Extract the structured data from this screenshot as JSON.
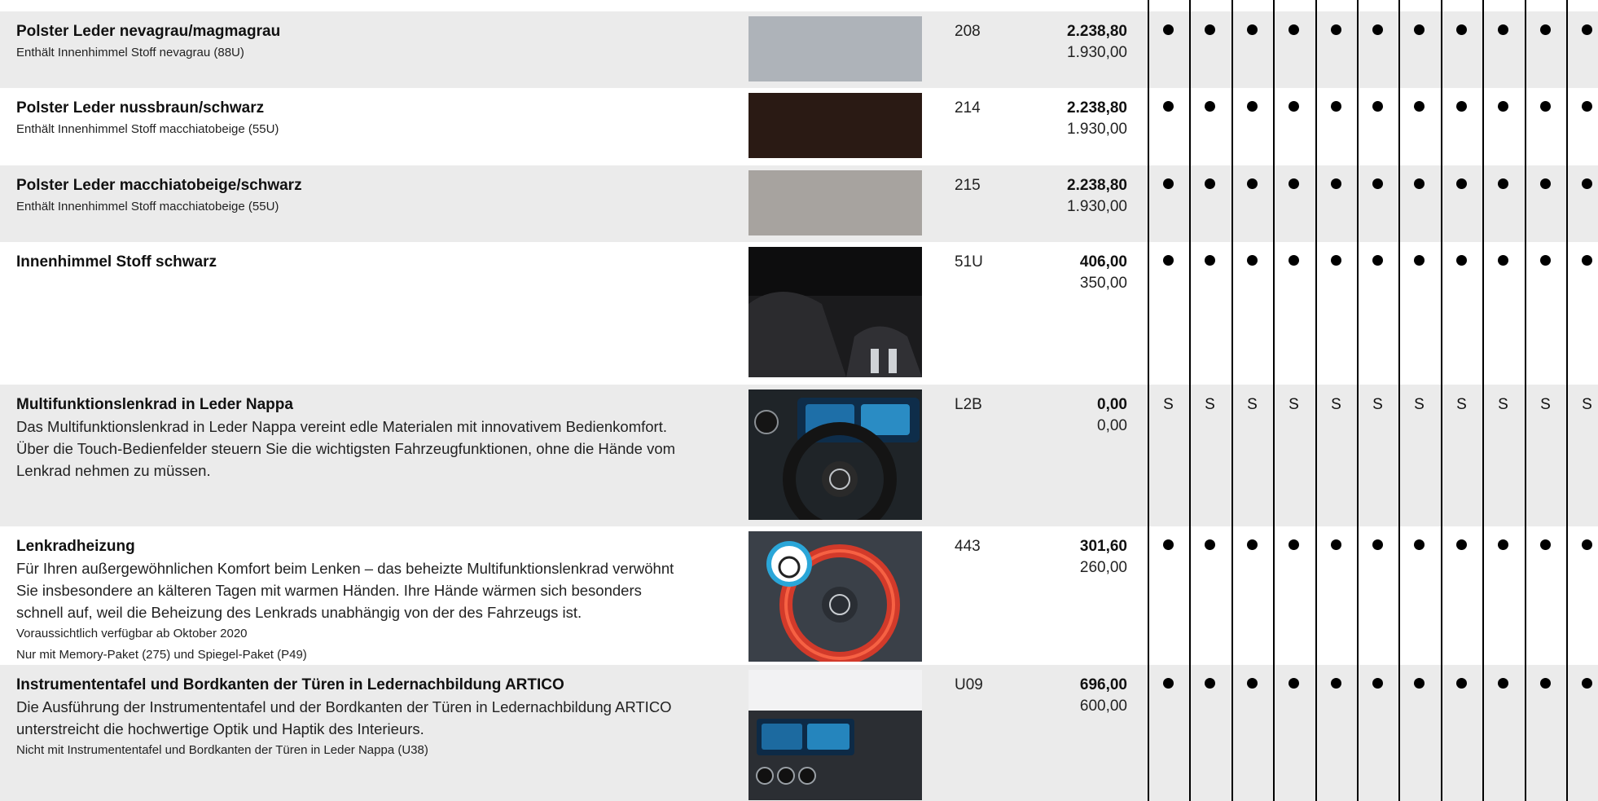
{
  "rows": [
    {
      "title": "Polster Leder nevagrau/magmagrau",
      "notes": [
        "Enthält Innenhimmel Stoff nevagrau (88U)"
      ],
      "description": [],
      "code": "208",
      "price_gross": "2.238,80",
      "price_net": "1.930,00",
      "marks": [
        "dot",
        "dot",
        "dot",
        "dot",
        "dot",
        "dot",
        "dot",
        "dot",
        "dot",
        "dot",
        "dot"
      ],
      "swatch_color": "#aeb3b9",
      "image": "upholstery-swatch-grey"
    },
    {
      "title": "Polster Leder nussbraun/schwarz",
      "notes": [
        "Enthält Innenhimmel Stoff macchiatobeige (55U)"
      ],
      "description": [],
      "code": "214",
      "price_gross": "2.238,80",
      "price_net": "1.930,00",
      "marks": [
        "dot",
        "dot",
        "dot",
        "dot",
        "dot",
        "dot",
        "dot",
        "dot",
        "dot",
        "dot",
        "dot"
      ],
      "swatch_color": "#2a1a14",
      "image": "upholstery-swatch-brown"
    },
    {
      "title": "Polster Leder macchiatobeige/schwarz",
      "notes": [
        "Enthält Innenhimmel Stoff macchiatobeige (55U)"
      ],
      "description": [],
      "code": "215",
      "price_gross": "2.238,80",
      "price_net": "1.930,00",
      "marks": [
        "dot",
        "dot",
        "dot",
        "dot",
        "dot",
        "dot",
        "dot",
        "dot",
        "dot",
        "dot",
        "dot"
      ],
      "swatch_color": "#a7a39f",
      "image": "upholstery-swatch-beige"
    },
    {
      "title": "Innenhimmel Stoff schwarz",
      "notes": [],
      "description": [],
      "code": "51U",
      "price_gross": "406,00",
      "price_net": "350,00",
      "marks": [
        "dot",
        "dot",
        "dot",
        "dot",
        "dot",
        "dot",
        "dot",
        "dot",
        "dot",
        "dot",
        "dot"
      ],
      "swatch_color": "#1b1b1d",
      "image": "headliner-photo"
    },
    {
      "title": "Multifunktionslenkrad in Leder Nappa",
      "notes": [],
      "description": [
        "Das Multifunktionslenkrad in Leder Nappa vereint edle Materialen mit innovativem Bedienkomfort.",
        "Über die Touch-Bedienfelder steuern Sie die wichtigsten Fahrzeugfunktionen, ohne die Hände vom",
        "Lenkrad nehmen zu müssen."
      ],
      "code": "L2B",
      "price_gross": "0,00",
      "price_net": "0,00",
      "marks": [
        "S",
        "S",
        "S",
        "S",
        "S",
        "S",
        "S",
        "S",
        "S",
        "S",
        "S"
      ],
      "swatch_color": "#1f2428",
      "image": "steering-wheel-photo"
    },
    {
      "title": "Lenkradheizung",
      "notes": [
        "Voraussichtlich verfügbar ab Oktober 2020",
        "Nur mit Memory-Paket (275) und Spiegel-Paket (P49)"
      ],
      "description": [
        "Für Ihren außergewöhnlichen Komfort beim Lenken – das beheizte Multifunktionslenkrad verwöhnt",
        "Sie insbesondere an kälteren Tagen mit warmen Händen. Ihre Hände wärmen sich besonders",
        "schnell auf, weil die Beheizung des Lenkrads unabhängig von der des Fahrzeugs ist."
      ],
      "code": "443",
      "price_gross": "301,60",
      "price_net": "260,00",
      "marks": [
        "dot",
        "dot",
        "dot",
        "dot",
        "dot",
        "dot",
        "dot",
        "dot",
        "dot",
        "dot",
        "dot"
      ],
      "swatch_color": "#3a4048",
      "image": "heated-steering-wheel-photo"
    },
    {
      "title": "Instrumententafel und Bordkanten der Türen in Ledernachbildung ARTICO",
      "notes": [
        "Nicht mit Instrumententafel und Bordkanten der Türen in Leder Nappa (U38)"
      ],
      "description": [
        "Die Ausführung der Instrumententafel und der Bordkanten der Türen in Ledernachbildung ARTICO",
        "unterstreicht die hochwertige Optik und Haptik des Interieurs."
      ],
      "code": "U09",
      "price_gross": "696,00",
      "price_net": "600,00",
      "marks": [
        "dot",
        "dot",
        "dot",
        "dot",
        "dot",
        "dot",
        "dot",
        "dot",
        "dot",
        "dot",
        "dot"
      ],
      "swatch_color": "#d9dadc",
      "image": "dashboard-photo"
    }
  ]
}
